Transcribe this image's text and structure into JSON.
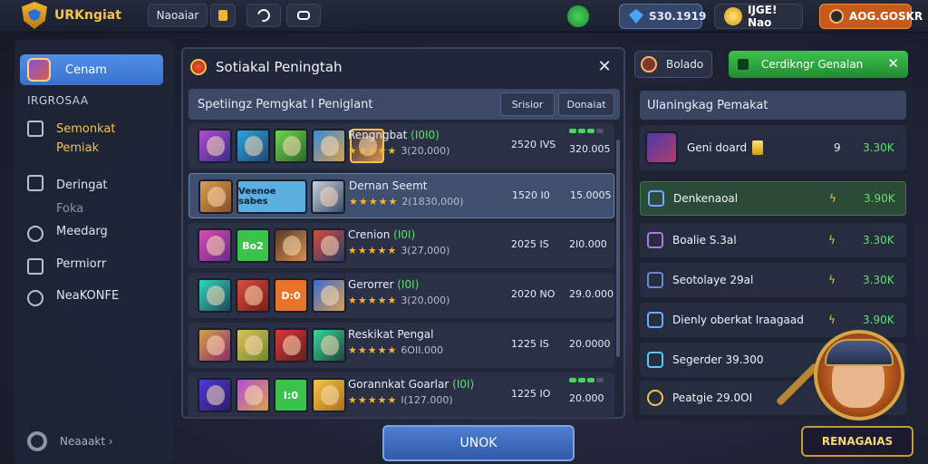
{
  "app": {
    "title": "URKngiat"
  },
  "topbar": {
    "menu_label": "Naoaiar",
    "gems": "S30.1919",
    "gold": "IJGE! Nao",
    "rank": "AOG.GOSKR"
  },
  "sidebar": {
    "active_label": "Cenam",
    "section": "IRGROSAA",
    "items": [
      {
        "line1": "Semonkat",
        "line2": "Pemiak"
      },
      {
        "line1": "Deringat",
        "line2": "Foka"
      },
      {
        "line1": "Meedarg"
      },
      {
        "line1": "Permiorr"
      },
      {
        "line1": "NeaKONFE"
      }
    ],
    "footer": "Neaaakt ›"
  },
  "modal": {
    "title": "Sotiakal Peningtah",
    "list_title": "Spetiingz Pemgkat I Peniglant",
    "sort_1": "Srisior",
    "sort_2": "Donaiat",
    "rows": [
      {
        "name": "Rengngbat",
        "tag": "(I0I0)",
        "score": "3(20,000)",
        "col1": "2520 IVS",
        "col2": "320.005",
        "bars": [
          1,
          1,
          1,
          0
        ],
        "heroes": [
          "",
          "",
          "",
          "",
          ""
        ],
        "selected": false
      },
      {
        "name": "Dernan Seemt",
        "tag": "",
        "score": "2(1830,000)",
        "col1": "1520 I0",
        "col2": "15.0005",
        "bars": [],
        "heroes": [
          "",
          "Veenoe sabes",
          ""
        ],
        "selected": true
      },
      {
        "name": "Crenion",
        "tag": "(I0I)",
        "score": "3(27,000)",
        "col1": "2025 IS",
        "col2": "2I0.000",
        "bars": [],
        "heroes": [
          "",
          "Bo2",
          "",
          ""
        ],
        "selected": false
      },
      {
        "name": "Gerorrer",
        "tag": "(I0I)",
        "score": "3(20,000)",
        "col1": "2020 NO",
        "col2": "29.0.000",
        "bars": [],
        "heroes": [
          "",
          "",
          "D:0",
          ""
        ],
        "selected": false
      },
      {
        "name": "Reskikat Pengal",
        "tag": "",
        "score": "6OII.000",
        "col1": "1225 IS",
        "col2": "20.0000",
        "bars": [],
        "heroes": [
          "",
          "",
          "",
          ""
        ],
        "selected": false
      },
      {
        "name": "Gorannkat Goarlar",
        "tag": "(I0I)",
        "score": "I(127.000)",
        "col1": "1225 IO",
        "col2": "20.000",
        "bars": [
          1,
          1,
          1,
          0
        ],
        "heroes": [
          "",
          "",
          "I:0",
          ""
        ],
        "selected": false
      }
    ],
    "confirm": "UNOK"
  },
  "right": {
    "tab1": "Bolado",
    "tab2": "Cerdikngr Genalan",
    "header": "Ulaningkag Pemakat",
    "rows": [
      {
        "label": "Geni doard",
        "num": "9",
        "val": "3.30K"
      },
      {
        "label": "Denkenaoal",
        "num": "",
        "val": "3.90K"
      },
      {
        "label": "Boalie S.3al",
        "num": "",
        "val": "3.30K"
      },
      {
        "label": "Seotolaye 29al",
        "num": "",
        "val": "3.30K"
      },
      {
        "label": "Dienly oberkat Iraagaad",
        "num": "",
        "val": "3.90K"
      },
      {
        "label": "Segerder 39.300",
        "num": "",
        "val": ""
      },
      {
        "label": "Peatgie 29.0OI",
        "num": "",
        "val": ""
      }
    ],
    "portrait_name": "RENAGAIAS"
  },
  "colors": {
    "accent": "#3f78d6",
    "success": "#3cc34d",
    "gold": "#f5c447"
  }
}
